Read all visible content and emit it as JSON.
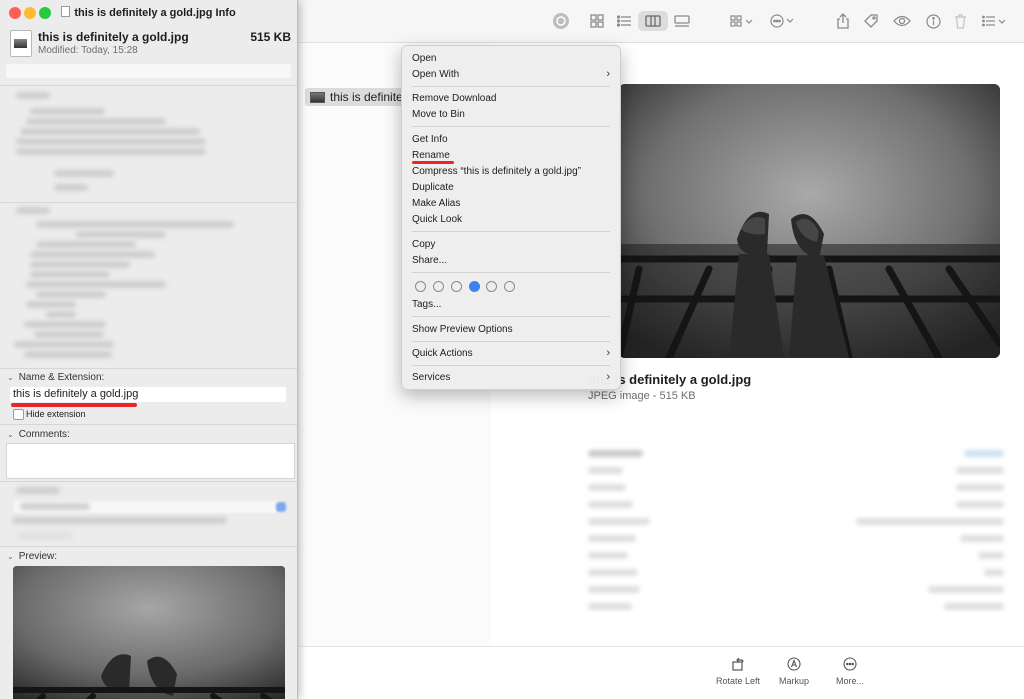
{
  "info_window": {
    "title": "this is definitely a gold.jpg Info",
    "filename": "this is definitely a gold.jpg",
    "filesize": "515 KB",
    "modified": "Modified: Today, 15:28",
    "section_name_extension": "Name & Extension:",
    "name_field_value": "this is definitely a gold.jpg",
    "hide_extension_label": "Hide extension",
    "section_comments": "Comments:",
    "section_preview": "Preview:"
  },
  "finder": {
    "selected_file_name": "this is definitely",
    "preview_title": "this is definitely a gold.jpg",
    "preview_subtitle": "JPEG image - 515 KB",
    "actions": [
      {
        "label": "Rotate Left",
        "icon": "rotate-left-icon"
      },
      {
        "label": "Markup",
        "icon": "markup-icon"
      },
      {
        "label": "More...",
        "icon": "more-icon"
      }
    ]
  },
  "context_menu": {
    "items": [
      {
        "label": "Open",
        "submenu": false
      },
      {
        "label": "Open With",
        "submenu": true
      },
      {
        "label": "Remove Download",
        "submenu": false
      },
      {
        "label": "Move to Bin",
        "submenu": false
      },
      {
        "label": "Get Info",
        "submenu": false
      },
      {
        "label": "Rename",
        "submenu": false,
        "highlighted_by_annotation": true
      },
      {
        "label": "Compress “this is definitely a gold.jpg”",
        "submenu": false
      },
      {
        "label": "Duplicate",
        "submenu": false
      },
      {
        "label": "Make Alias",
        "submenu": false
      },
      {
        "label": "Quick Look",
        "submenu": false
      },
      {
        "label": "Copy",
        "submenu": false
      },
      {
        "label": "Share...",
        "submenu": false
      },
      {
        "label": "Tags...",
        "submenu": false
      },
      {
        "label": "Show Preview Options",
        "submenu": false
      },
      {
        "label": "Quick Actions",
        "submenu": true
      },
      {
        "label": "Services",
        "submenu": true
      }
    ],
    "tag_colors": [
      "none",
      "none",
      "none",
      "#3b82f6",
      "none",
      "none"
    ]
  },
  "colors": {
    "annotation_red": "#e8262a",
    "close": "#ff5f57",
    "minimize": "#febc2e",
    "zoom": "#28c840",
    "tag_blue": "#3b82f6"
  },
  "toolbar_icons": [
    "airdrop-icon",
    "icon-view-icon",
    "list-view-icon",
    "column-view-icon",
    "gallery-view-icon",
    "group-icon",
    "action-icon",
    "share-icon",
    "tag-icon",
    "quick-look-icon",
    "info-icon",
    "trash-icon",
    "list-options-icon"
  ]
}
